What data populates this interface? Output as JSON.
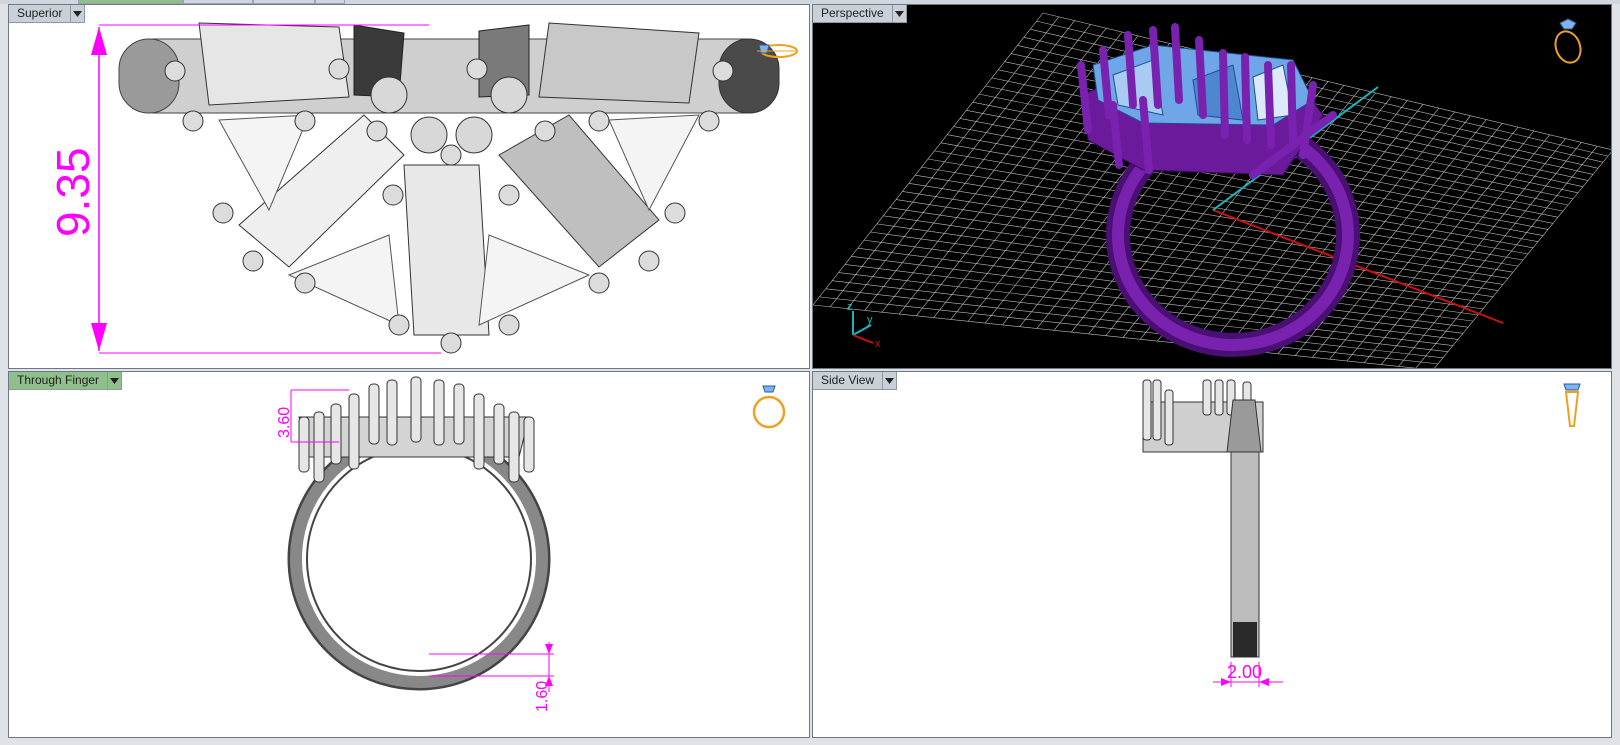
{
  "viewports": {
    "top_left": {
      "label": "Superior",
      "dimension": "9.35"
    },
    "top_right": {
      "label": "Perspective",
      "axes": {
        "z": "z",
        "y": "y",
        "x": "x"
      }
    },
    "bottom_left": {
      "label": "Through Finger",
      "dim_top": "3.60",
      "dim_bottom": "1.60"
    },
    "bottom_right": {
      "label": "Side View",
      "dim": "2.00"
    }
  },
  "icons": {
    "ring_top": "ring-top-view-icon",
    "ring_perspective": "ring-perspective-icon",
    "ring_front": "ring-front-view-icon",
    "ring_side": "ring-side-view-icon",
    "dropdown": "chevron-down-icon"
  },
  "colors": {
    "dimension": "#ff00ff",
    "ring_metal": "#6a1a9a",
    "gem": "#6fa6e8",
    "grid": "#cfcfcf",
    "axis_x": "#d01010",
    "axis_y": "#19b5c0",
    "active_tab": "#8fbf8a",
    "icon_gold": "#f0a020"
  }
}
